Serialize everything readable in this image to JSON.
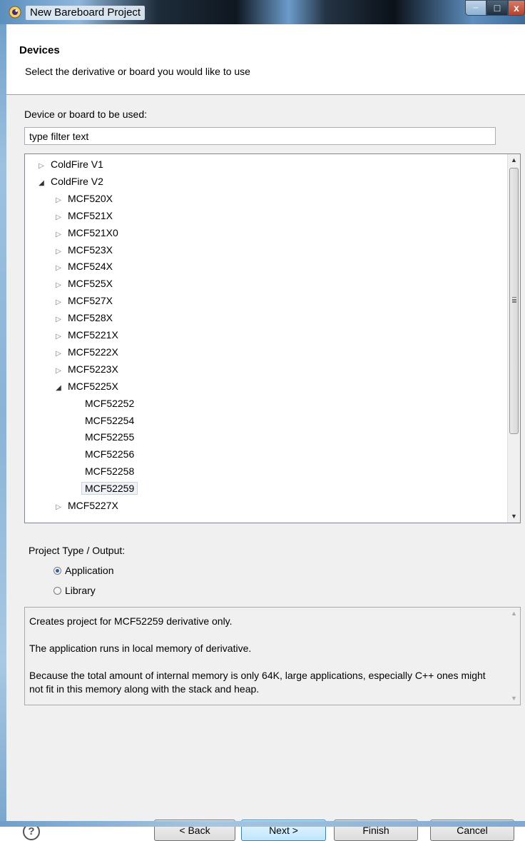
{
  "window": {
    "title": "New Bareboard Project",
    "controls": {
      "minimize": "─",
      "maximize": "□",
      "close": "x"
    }
  },
  "header": {
    "title": "Devices",
    "description": "Select the derivative or board you would like to use"
  },
  "device_section": {
    "label": "Device or board to be used:",
    "filter_value": "type filter text"
  },
  "tree": {
    "items": [
      {
        "label": "ColdFire V1",
        "state": "collapsed"
      },
      {
        "label": "ColdFire V2",
        "state": "expanded"
      },
      {
        "label": "MCF520X",
        "state": "collapsed"
      },
      {
        "label": "MCF521X",
        "state": "collapsed"
      },
      {
        "label": "MCF521X0",
        "state": "collapsed"
      },
      {
        "label": "MCF523X",
        "state": "collapsed"
      },
      {
        "label": "MCF524X",
        "state": "collapsed"
      },
      {
        "label": "MCF525X",
        "state": "collapsed"
      },
      {
        "label": "MCF527X",
        "state": "collapsed"
      },
      {
        "label": "MCF528X",
        "state": "collapsed"
      },
      {
        "label": "MCF5221X",
        "state": "collapsed"
      },
      {
        "label": "MCF5222X",
        "state": "collapsed"
      },
      {
        "label": "MCF5223X",
        "state": "collapsed"
      },
      {
        "label": "MCF5225X",
        "state": "expanded"
      },
      {
        "label": "MCF52252",
        "state": "leaf"
      },
      {
        "label": "MCF52254",
        "state": "leaf"
      },
      {
        "label": "MCF52255",
        "state": "leaf"
      },
      {
        "label": "MCF52256",
        "state": "leaf"
      },
      {
        "label": "MCF52258",
        "state": "leaf"
      },
      {
        "label": "MCF52259",
        "state": "leaf",
        "selected": true
      },
      {
        "label": "MCF5227X",
        "state": "collapsed"
      }
    ],
    "expand_glyph": "◢",
    "collapse_glyph": "▷",
    "scroll_up": "▲",
    "scroll_down": "▼"
  },
  "project_type": {
    "label": "Project Type / Output:",
    "options": [
      {
        "label": "Application",
        "selected": true
      },
      {
        "label": "Library",
        "selected": false
      }
    ]
  },
  "description_box": {
    "line1": "Creates project for MCF52259 derivative only.",
    "line2": "The application runs in local memory of derivative.",
    "line3": "Because the total amount of internal memory is only 64K, large applications, especially C++ ones might not fit in this memory along with the stack and heap."
  },
  "footer": {
    "help_label": "?",
    "back_label": "< Back",
    "next_label": "Next >",
    "finish_label": "Finish",
    "cancel_label": "Cancel"
  }
}
